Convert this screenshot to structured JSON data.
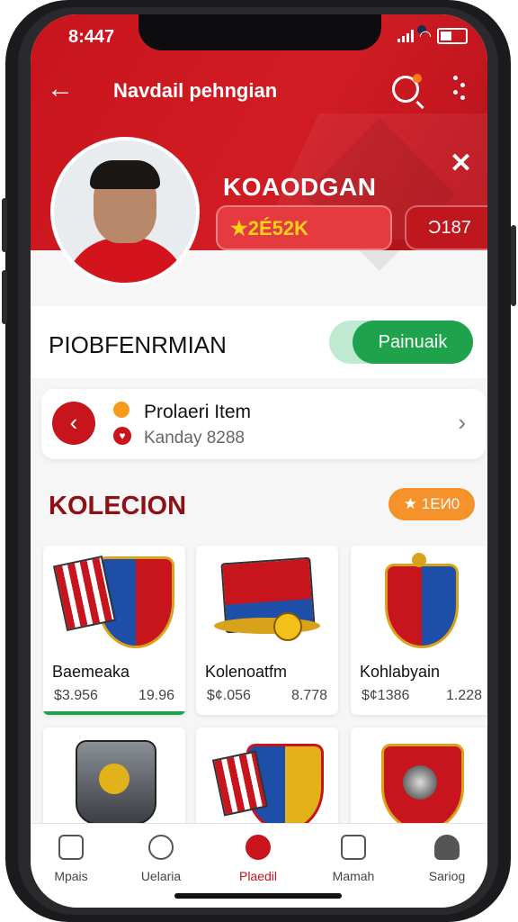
{
  "status": {
    "time": "8:447"
  },
  "header": {
    "title": "Navdail pehngian"
  },
  "profile": {
    "name": "KOAODGAN",
    "rank": "★2É52K",
    "points": "Ɔ187"
  },
  "performance": {
    "title": "PIOBFENRMIAN",
    "button_label": "Painuaik"
  },
  "item": {
    "name": "Prolaeri Item",
    "sub": "Kanday 8288"
  },
  "collection": {
    "title": "KOLECION",
    "badge": "★ 1EИ0",
    "cards": [
      {
        "name": "Baemeaka",
        "price": "$3.956",
        "pts": "19.96"
      },
      {
        "name": "Kolenoatfm",
        "price": "$¢.056",
        "pts": "8.778"
      },
      {
        "name": "Kohlabyain",
        "price": "$¢1386",
        "pts": "1.228"
      }
    ]
  },
  "tabs": [
    {
      "label": "Mpais",
      "icon": "home-icon"
    },
    {
      "label": "Uelaria",
      "icon": "shield-icon"
    },
    {
      "label": "Plaedil",
      "icon": "badge-icon"
    },
    {
      "label": "Mamah",
      "icon": "grid-icon"
    },
    {
      "label": "Sariog",
      "icon": "user-icon"
    }
  ],
  "colors": {
    "accent": "#c8141c",
    "success": "#1ea34c",
    "badge": "#f5922a"
  }
}
